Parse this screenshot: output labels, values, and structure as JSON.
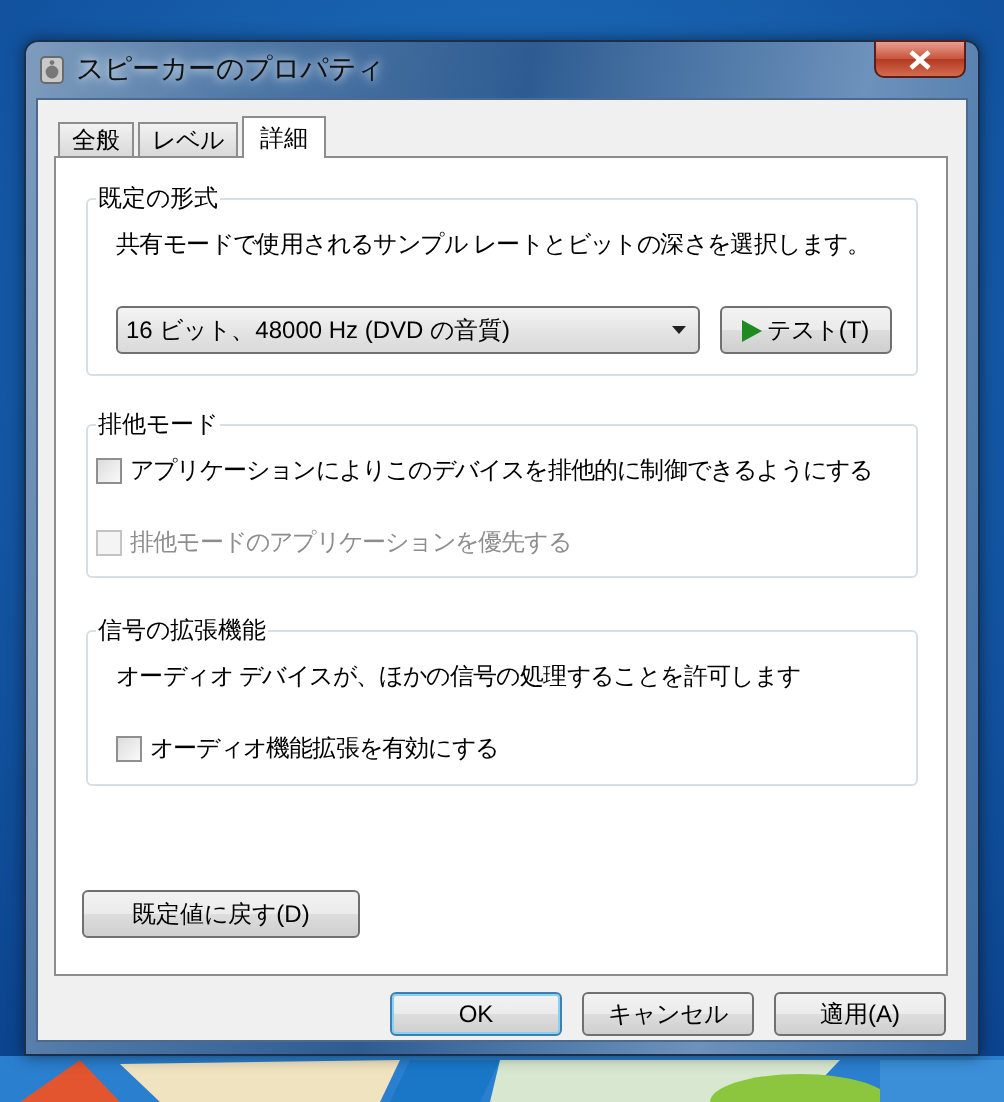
{
  "window": {
    "title": "スピーカーのプロパティ"
  },
  "tabs": [
    {
      "label": "全般",
      "selected": false
    },
    {
      "label": "レベル",
      "selected": false
    },
    {
      "label": "詳細",
      "selected": true
    }
  ],
  "default_format": {
    "title": "既定の形式",
    "description": "共有モードで使用されるサンプル レートとビットの深さを選択します。",
    "dropdown_value": "16 ビット、48000 Hz (DVD の音質)",
    "test_button": "テスト(T)"
  },
  "exclusive_mode": {
    "title": "排他モード",
    "options": [
      {
        "label": "アプリケーションによりこのデバイスを排他的に制御できるようにする",
        "checked": false,
        "disabled": false
      },
      {
        "label": "排他モードのアプリケーションを優先する",
        "checked": false,
        "disabled": true
      }
    ]
  },
  "enhancements": {
    "title": "信号の拡張機能",
    "description": "オーディオ デバイスが、ほかの信号の処理することを許可します",
    "options": [
      {
        "label": "オーディオ機能拡張を有効にする",
        "checked": false,
        "disabled": false
      }
    ]
  },
  "restore_button": "既定値に戻す(D)",
  "buttons": [
    {
      "label": "OK",
      "default": true
    },
    {
      "label": "キャンセル",
      "default": false
    },
    {
      "label": "適用(A)",
      "default": false
    }
  ]
}
